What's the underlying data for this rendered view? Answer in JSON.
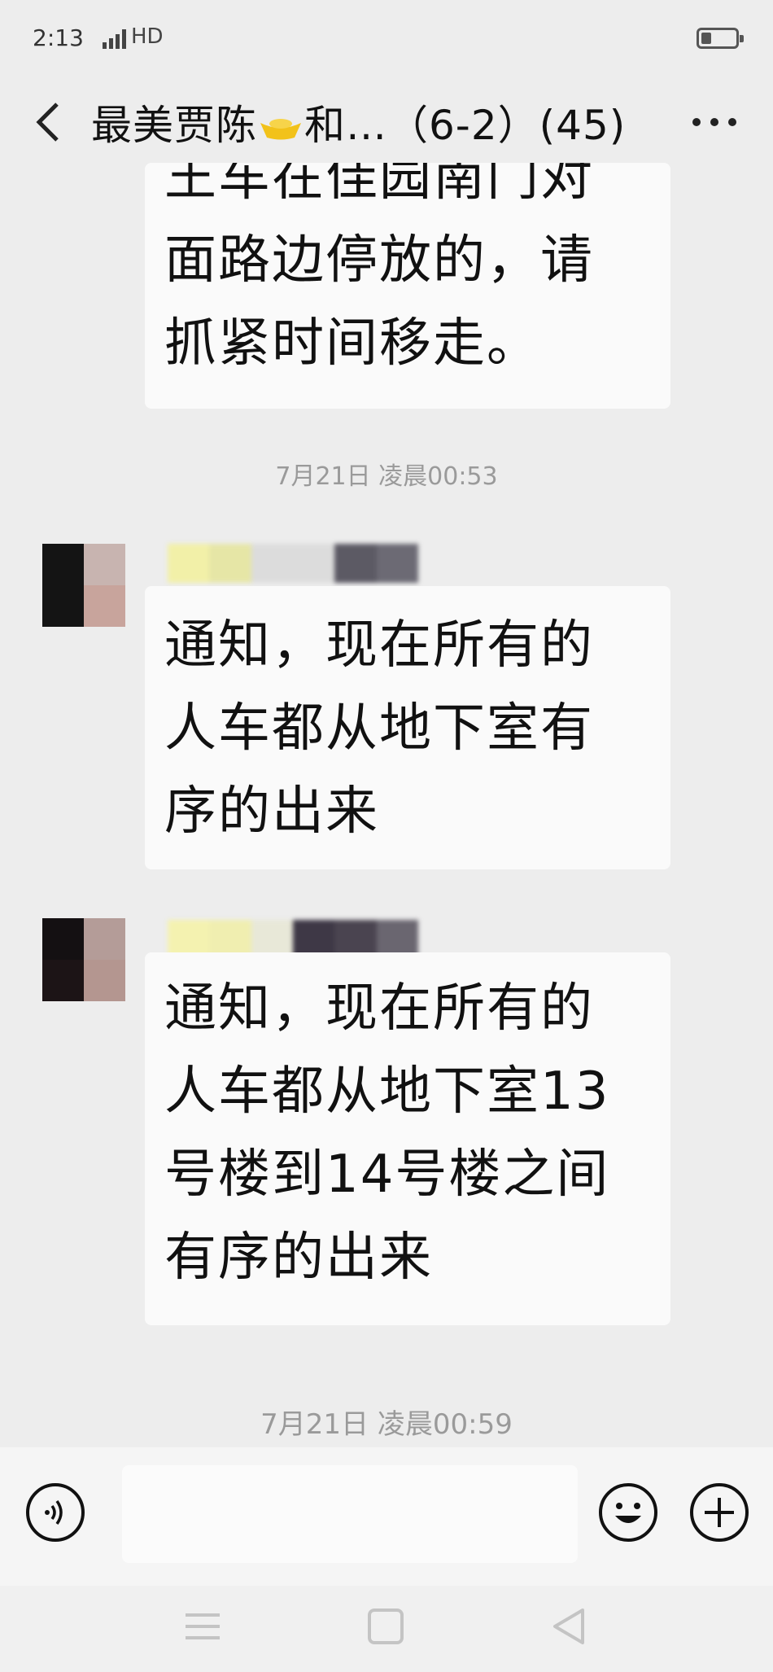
{
  "status_bar": {
    "time": "2:13",
    "network": "HD",
    "battery_level": 0.3
  },
  "header": {
    "title_prefix": "最美贾陈",
    "title_suffix": "和…（6-2）(45)",
    "back_icon": "chevron-left-icon",
    "more_icon": "more-dots-icon"
  },
  "messages": [
    {
      "lines": [
        "王车在佳园南门对",
        "面路边停放的，请",
        "抓紧时间移走。"
      ]
    },
    {
      "lines": [
        "通知，现在所有的",
        "人车都从地下室有",
        "序的出来"
      ]
    },
    {
      "lines": [
        "通知，现在所有的",
        "人车都从地下室13",
        "号楼到14号楼之间",
        "有序的出来"
      ]
    }
  ],
  "timestamps": [
    "7月21日 凌晨00:53",
    "7月21日 凌晨00:59"
  ],
  "senders": [
    {
      "avatar_colors": [
        "#141414",
        "#c8b4b0",
        "#141414",
        "#c8a49c"
      ],
      "nickname_colors": [
        "#f2f0a8",
        "#e6e6a6",
        "#dcdcdc",
        "#dcdcdc",
        "#5c5a64",
        "#6c6a74"
      ]
    },
    {
      "avatar_colors": [
        "#141012",
        "#b49c98",
        "#1c1416",
        "#b49690"
      ],
      "nickname_colors": [
        "#f4f2b0",
        "#f0eeb0",
        "#e8e8d8",
        "#3e3846",
        "#4a4450",
        "#6a6670"
      ]
    }
  ],
  "input_bar": {
    "voice_icon": "voice-icon",
    "emoji_icon": "smiley-icon",
    "plus_icon": "plus-icon"
  },
  "nav_bar": {
    "menu_icon": "menu-icon",
    "home_icon": "home-icon",
    "back_icon": "triangle-back-icon"
  }
}
